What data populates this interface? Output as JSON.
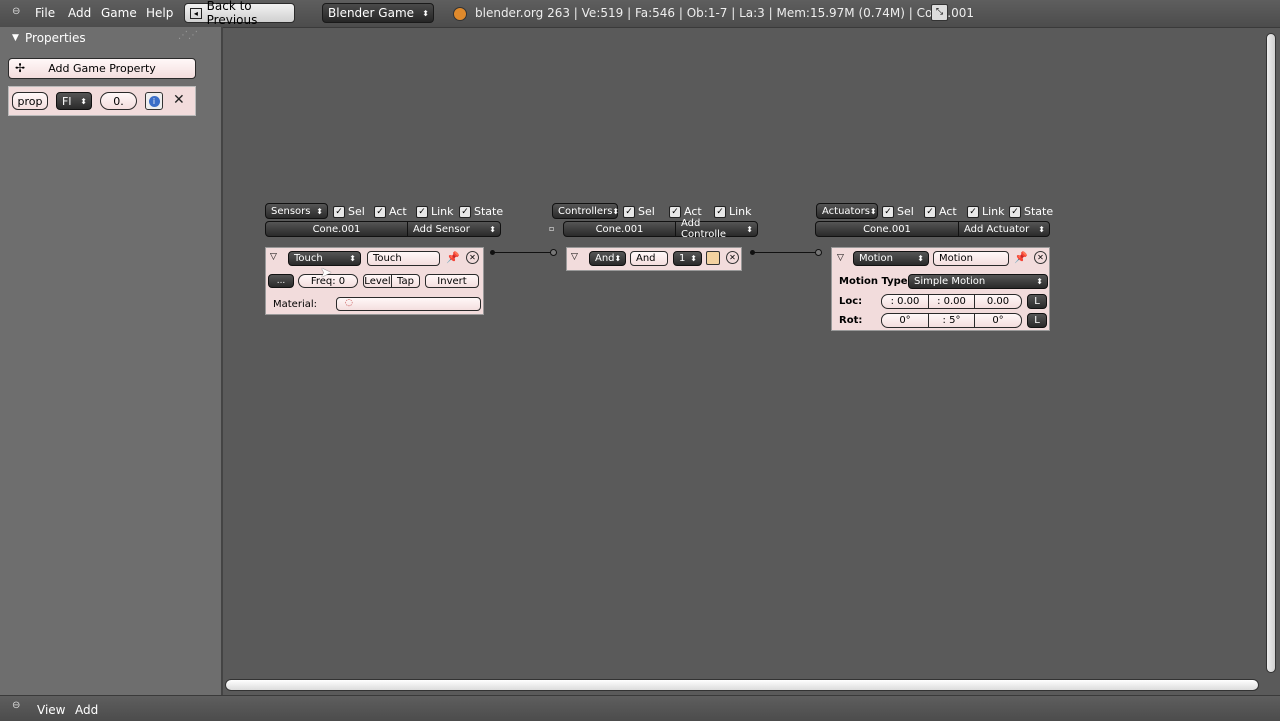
{
  "topbar": {
    "menu": [
      "File",
      "Add",
      "Game",
      "Help"
    ],
    "back_label": "Back to Previous",
    "engine": "Blender Game",
    "info": "blender.org 263 | Ve:519 | Fa:546 | Ob:1-7 | La:3 | Mem:15.97M (0.74M) | Cone.001"
  },
  "properties": {
    "title": "Properties",
    "add_label": "Add Game Property",
    "prop": {
      "name": "prop",
      "type": "Fl",
      "value": "0."
    }
  },
  "sensors": {
    "header": "Sensors",
    "checks": [
      "Sel",
      "Act",
      "Link",
      "State"
    ],
    "object": "Cone.001",
    "add": "Add Sensor",
    "brick": {
      "type": "Touch",
      "name": "Touch",
      "dots": "...",
      "freq": "Freq: 0",
      "level": "Level",
      "tap": "Tap",
      "invert": "Invert",
      "material_label": "Material:"
    }
  },
  "controllers": {
    "header": "Controllers",
    "checks": [
      "Sel",
      "Act",
      "Link"
    ],
    "object": "Cone.001",
    "add": "Add Controlle",
    "brick": {
      "type": "And",
      "name": "And",
      "state": "1"
    }
  },
  "actuators": {
    "header": "Actuators",
    "checks": [
      "Sel",
      "Act",
      "Link",
      "State"
    ],
    "object": "Cone.001",
    "add": "Add Actuator",
    "brick": {
      "type": "Motion",
      "name": "Motion",
      "motion_type_label": "Motion Type:",
      "motion_type": "Simple Motion",
      "loc_label": "Loc:",
      "loc": [
        ": 0.00",
        ": 0.00",
        "0.00"
      ],
      "rot_label": "Rot:",
      "rot": [
        "0°",
        ": 5°",
        "0°"
      ],
      "local": "L"
    }
  },
  "bottombar": {
    "menu": [
      "View",
      "Add"
    ]
  }
}
